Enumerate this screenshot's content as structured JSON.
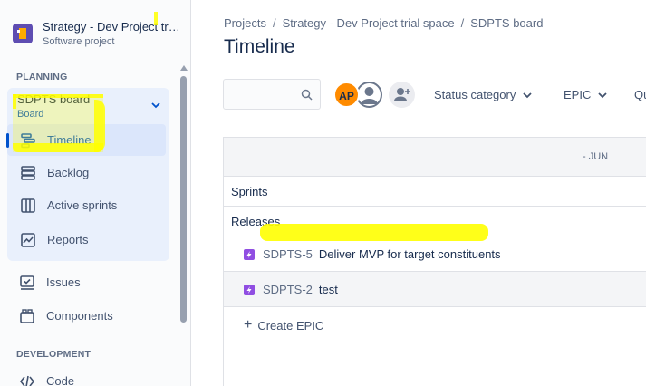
{
  "project": {
    "name": "Strategy - Dev Project trial space",
    "type": "Software project"
  },
  "sidebar": {
    "planning_label": "PLANNING",
    "board": {
      "name": "SDPTS board",
      "sub": "Board"
    },
    "board_items": [
      {
        "label": "Timeline",
        "icon": "timeline-icon",
        "active": true
      },
      {
        "label": "Backlog",
        "icon": "backlog-icon"
      },
      {
        "label": "Active sprints",
        "icon": "active-sprints-icon"
      },
      {
        "label": "Reports",
        "icon": "reports-icon"
      }
    ],
    "items": [
      {
        "label": "Issues",
        "icon": "issues-icon"
      },
      {
        "label": "Components",
        "icon": "components-icon"
      }
    ],
    "development_label": "DEVELOPMENT",
    "dev_items": [
      {
        "label": "Code",
        "icon": "code-icon"
      }
    ]
  },
  "breadcrumb": [
    "Projects",
    "Strategy - Dev Project trial space",
    "SDPTS board"
  ],
  "page_title": "Timeline",
  "toolbar": {
    "search_placeholder": "",
    "avatar_initials": "AP",
    "filters": [
      "Status category",
      "EPIC",
      "Qu"
    ]
  },
  "timeline": {
    "month_label": "- JUN",
    "sprints_label": "Sprints",
    "releases_label": "Releases",
    "epics": [
      {
        "key": "SDPTS-5",
        "summary": "Deliver MVP for target constituents"
      },
      {
        "key": "SDPTS-2",
        "summary": "test"
      }
    ],
    "create_label": "Create EPIC"
  },
  "colors": {
    "accent": "#0052cc",
    "epic": "#904ee2",
    "avatar": "#ff8b00",
    "highlight": "#ffff00",
    "project_icon": "#5e4db2"
  }
}
